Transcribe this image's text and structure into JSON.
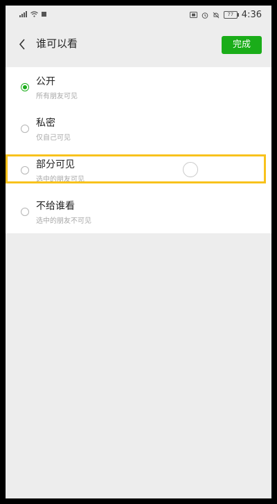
{
  "status_bar": {
    "time": "4:36",
    "battery": "77"
  },
  "header": {
    "title": "谁可以看",
    "done_label": "完成"
  },
  "options": [
    {
      "title": "公开",
      "desc": "所有朋友可见",
      "checked": true
    },
    {
      "title": "私密",
      "desc": "仅自己可见",
      "checked": false
    },
    {
      "title": "部分可见",
      "desc": "选中的朋友可见",
      "checked": false
    },
    {
      "title": "不给谁看",
      "desc": "选中的朋友不可见",
      "checked": false
    }
  ],
  "colors": {
    "accent": "#1aad19",
    "highlight": "#f8c21c",
    "background": "#ededed"
  }
}
